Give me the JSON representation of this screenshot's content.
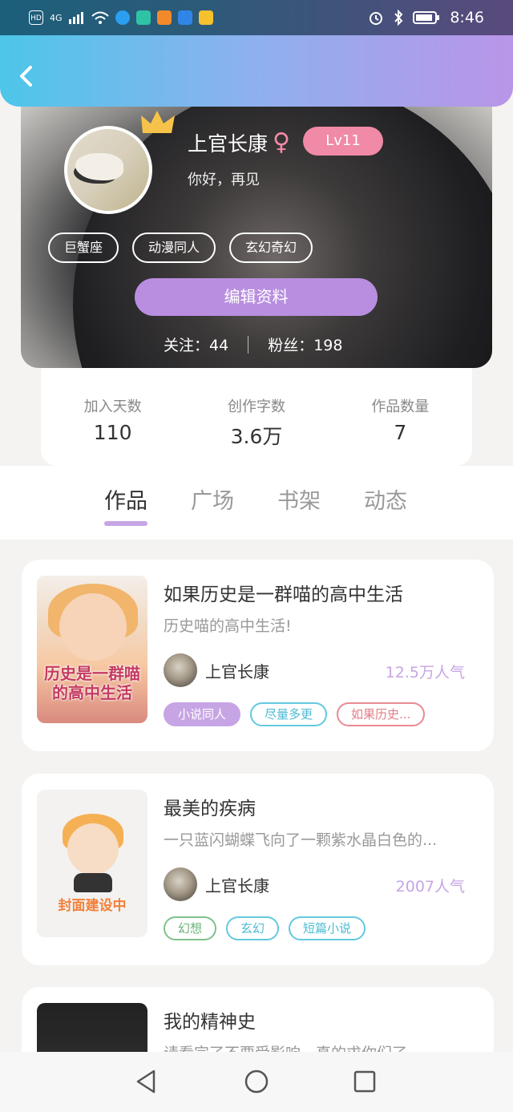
{
  "status_bar": {
    "left_indicators": [
      "HD",
      "4G"
    ],
    "time": "8:46"
  },
  "header": {
    "back_icon": "chevron-left-icon"
  },
  "profile": {
    "name": "上官长康",
    "gender_symbol": "♀",
    "level": "Lv11",
    "signature": "你好，再见",
    "tags": [
      "巨蟹座",
      "动漫同人",
      "玄幻奇幻"
    ],
    "edit_label": "编辑资料",
    "follow_label": "关注：44",
    "fans_label": "粉丝：198"
  },
  "stats": [
    {
      "label": "加入天数",
      "value": "110"
    },
    {
      "label": "创作字数",
      "value": "3.6万"
    },
    {
      "label": "作品数量",
      "value": "7"
    }
  ],
  "tabs": [
    "作品",
    "广场",
    "书架",
    "动态"
  ],
  "active_tab": "作品",
  "works": [
    {
      "title": "如果历史是一群喵的高中生活",
      "desc": "历史喵的高中生活!",
      "author": "上官长康",
      "popularity": "12.5万人气",
      "cover_text": "历史是一群喵的高中生活",
      "tags": [
        "小说同人",
        "尽量多更",
        "如果历史..."
      ]
    },
    {
      "title": "最美的疾病",
      "desc": "一只蓝闪蝴蝶飞向了一颗紫水晶白色的...",
      "author": "上官长康",
      "popularity": "2007人气",
      "cover_text": "封面建设中",
      "tags": [
        "幻想",
        "玄幻",
        "短篇小说"
      ]
    },
    {
      "title": "我的精神史",
      "desc": "请看完了不要受影响，真的求你们了"
    }
  ],
  "colors": {
    "accent": "#c7a5e5",
    "level_badge": "#f08aa6",
    "header_gradient_start": "#4dc6ea",
    "header_gradient_end": "#b995e8"
  }
}
